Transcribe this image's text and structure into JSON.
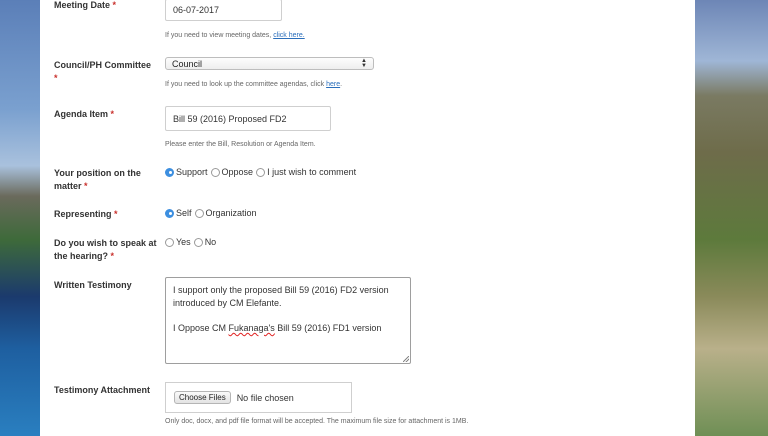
{
  "form": {
    "meeting_date": {
      "label": "Meeting Date",
      "required_mark": "*",
      "value": "06-07-2017",
      "help_text": "If you need to view meeting dates,",
      "help_link": "click here."
    },
    "council_committee": {
      "label": "Council/PH Committee",
      "required_mark": "*",
      "selected": "Council",
      "help_text": "If you need to look up the committee agendas, click",
      "help_link": "here",
      "help_suffix": "."
    },
    "agenda_item": {
      "label": "Agenda Item",
      "required_mark": "*",
      "value": "Bill 59 (2016) Proposed FD2",
      "help_text": "Please enter the Bill, Resolution or Agenda Item."
    },
    "position": {
      "label_line1": "Your position on the",
      "label_line2": "matter",
      "required_mark": "*",
      "options": [
        "Support",
        "Oppose",
        "I just wish to comment"
      ],
      "selected": "Support"
    },
    "representing": {
      "label": "Representing",
      "required_mark": "*",
      "options": [
        "Self",
        "Organization"
      ],
      "selected": "Self"
    },
    "speak": {
      "label_line1": "Do you wish to speak at",
      "label_line2": "the hearing?",
      "required_mark": "*",
      "options": [
        "Yes",
        "No"
      ],
      "selected": ""
    },
    "testimony": {
      "label": "Written Testimony",
      "line1": "I support only the proposed Bill 59 (2016) FD2 version",
      "line2": "introduced by CM Elefante.",
      "line3_prefix": "I Oppose CM ",
      "line3_misspelled": "Fukanaga's",
      "line3_suffix": " Bill 59 (2016)  FD1 version"
    },
    "attachment": {
      "label": "Testimony Attachment",
      "button": "Choose Files",
      "status": "No file chosen",
      "help_text": "Only doc, docx, and pdf file format will be accepted. The maximum file size for attachment is 1MB."
    }
  }
}
